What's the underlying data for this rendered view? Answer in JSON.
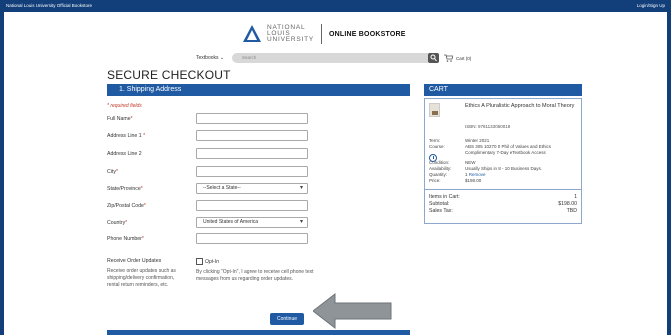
{
  "topbar": {
    "left_text": "National Louis University Official Bookstore",
    "right_text": "Login/Sign Up"
  },
  "logo": {
    "nlu_line1": "NATIONAL",
    "nlu_line2": "LOUIS",
    "nlu_line3": "UNIVERSITY",
    "store_name": "ONLINE BOOKSTORE"
  },
  "nav": {
    "textbooks_label": "Textbooks",
    "search_placeholder": "Search",
    "cart_label": "Cart (0)"
  },
  "page": {
    "title": "SECURE CHECKOUT",
    "section_title": "1. Shipping Address",
    "required_note": "* required fields"
  },
  "form": {
    "full_name": {
      "label": "Full Name",
      "star": "*",
      "value": ""
    },
    "address1": {
      "label": "Address Line 1",
      "star": "*",
      "value": ""
    },
    "address2": {
      "label": "Address Line 2",
      "value": ""
    },
    "city": {
      "label": "City",
      "star": "*",
      "value": ""
    },
    "state": {
      "label": "State/Province",
      "star": "*",
      "value": "--Select a State--"
    },
    "zip": {
      "label": "Zip/Postal Code",
      "star": "*",
      "value": ""
    },
    "country": {
      "label": "Country",
      "star": "*",
      "value": "United States of America"
    },
    "phone": {
      "label": "Phone Number",
      "star": "*",
      "value": ""
    },
    "updates_label": "Receive Order Updates",
    "updates_desc": "Receive order updates such as shipping/delivery confirmation, rental return reminders, etc.",
    "optin_label": "Opt-In",
    "optin_text": "By clicking \"Opt-In\", I agree to receive cell phone text messages from us regarding order updates.",
    "continue_label": "Continue"
  },
  "cart": {
    "title": "CART",
    "book_title": "Ethics A Pluralistic Approach to Moral Theory",
    "isbn": "ISBN: 9781133050018",
    "term_key": "Term:",
    "term_val": "Winter 2021",
    "course_key": "Course:",
    "course_val": "ABS 305 10270 0 Phil of Values and Ethics",
    "access_val": "Complimentary 7-Day eTextbook Access",
    "condition_key": "Condition:",
    "condition_val": "NEW",
    "availability_key": "Availability:",
    "availability_val": "Usually Ships in 8 - 10 Business Days.",
    "quantity_key": "Quantity:",
    "quantity_val": "1",
    "remove_label": "Remove",
    "price_key": "Price:",
    "price_val": "$198.00",
    "items_label": "Items in Cart:",
    "items_val": "1",
    "subtotal_label": "Subtotal:",
    "subtotal_val": "$198.00",
    "tax_label": "Sales Tax:",
    "tax_val": "TBD"
  },
  "colors": {
    "accent": "#1f5aa3",
    "topbar": "#123e7a",
    "required": "#c0392b"
  }
}
